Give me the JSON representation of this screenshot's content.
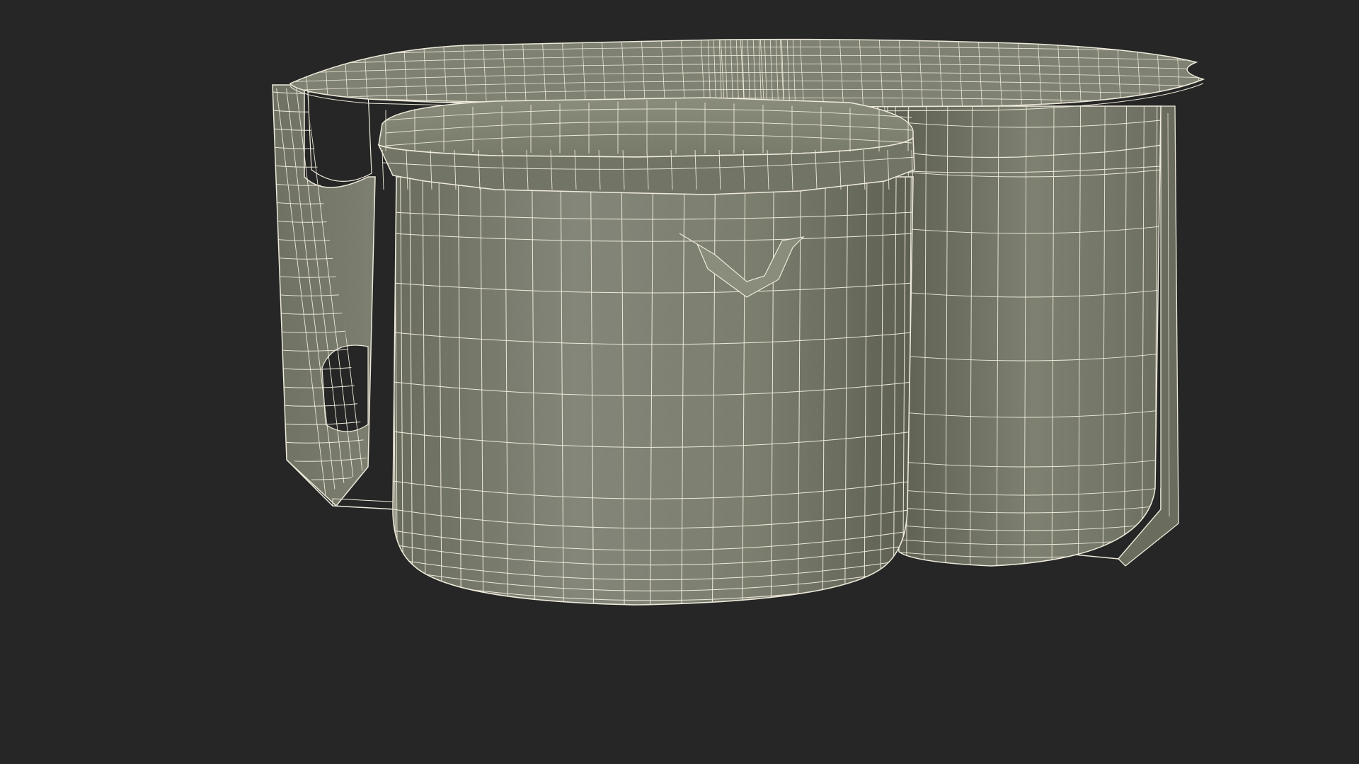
{
  "scene": {
    "subject": "yogurt-cups-pack-wireframe",
    "colors": {
      "background": "#262626",
      "surface": "#7d7f6e",
      "surface_light": "#8c8e7d",
      "surface_dark": "#5c5e50",
      "inner_shadow": "#3e4036",
      "wire": "#eeeadb"
    }
  }
}
